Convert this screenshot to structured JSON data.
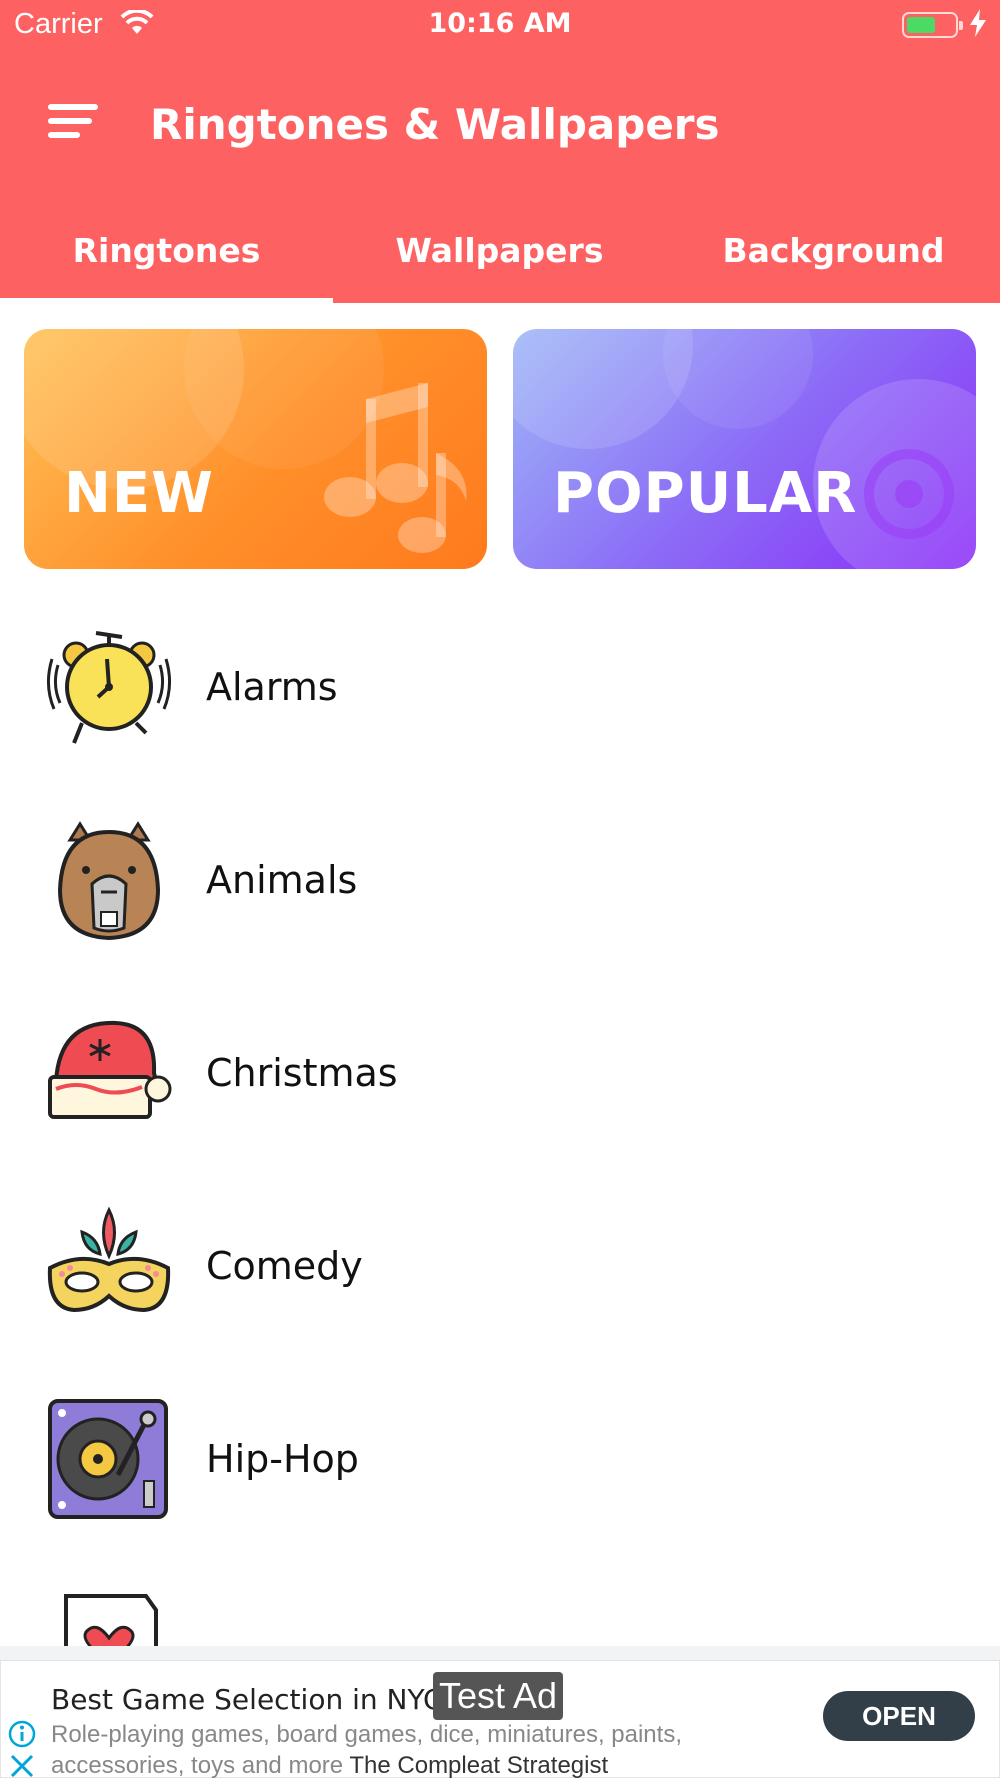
{
  "status_bar": {
    "carrier": "Carrier",
    "time": "10:16 AM"
  },
  "header": {
    "title": "Ringtones & Wallpapers"
  },
  "tabs": [
    {
      "label": "Ringtones",
      "selected": true
    },
    {
      "label": "Wallpapers",
      "selected": false
    },
    {
      "label": "Background",
      "selected": false
    }
  ],
  "cards": {
    "new_label": "NEW",
    "popular_label": "POPULAR"
  },
  "categories": [
    {
      "label": "Alarms",
      "icon": "alarm-clock-icon"
    },
    {
      "label": "Animals",
      "icon": "capybara-icon"
    },
    {
      "label": "Christmas",
      "icon": "santa-hat-icon"
    },
    {
      "label": "Comedy",
      "icon": "carnival-mask-icon"
    },
    {
      "label": "Hip-Hop",
      "icon": "turntable-icon"
    }
  ],
  "ad": {
    "title": "Best Game Selection in NYC",
    "badge": "Test Ad",
    "description": "Role-playing games, board games, dice, miniatures, paints, accessories, toys and more",
    "advertiser": "The Compleat Strategist",
    "cta": "OPEN"
  },
  "colors": {
    "header": "#fd6161",
    "new_card": "#ff8f2a",
    "popular_card": "#8c6ef7",
    "ad_button": "#333f48"
  }
}
